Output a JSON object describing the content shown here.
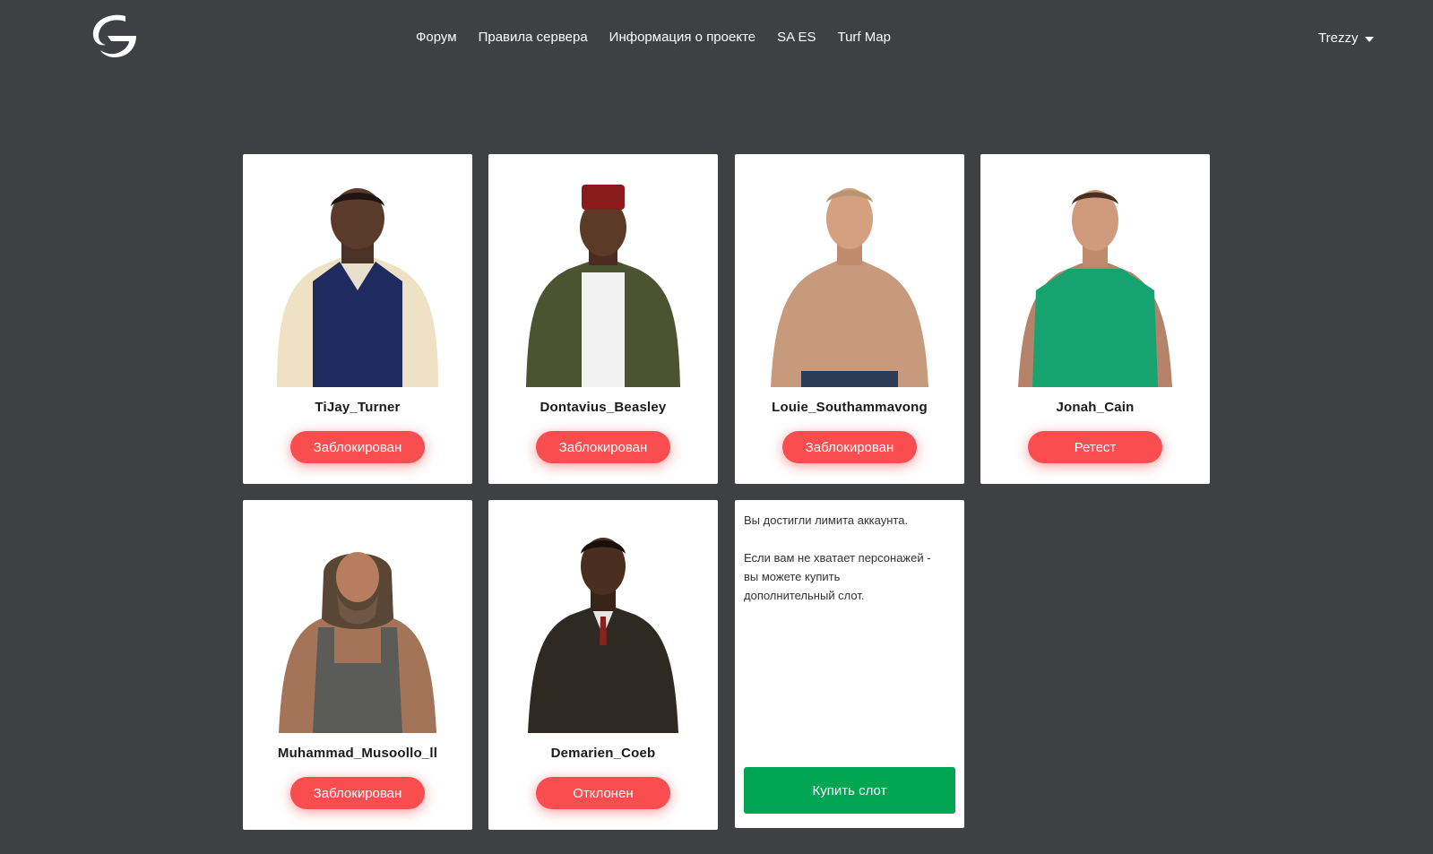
{
  "header": {
    "nav": [
      "Форум",
      "Правила сервера",
      "Информация о проекте",
      "SA ES",
      "Turf Map"
    ],
    "user": "Trezzy"
  },
  "characters": [
    {
      "name": "TiJay_Turner",
      "status": "Заблокирован"
    },
    {
      "name": "Dontavius_Beasley",
      "status": "Заблокирован"
    },
    {
      "name": "Louie_Southammavong",
      "status": "Заблокирован"
    },
    {
      "name": "Jonah_Cain",
      "status": "Ретест"
    },
    {
      "name": "Muhammad_Musoollo_ll",
      "status": "Заблокирован"
    },
    {
      "name": "Demarien_Coeb",
      "status": "Отклонен"
    }
  ],
  "limit_card": {
    "text": "Вы достигли лимита аккаунта.\n\nЕсли вам не хватает персонажей -\nвы можете купить\nдополнительный слот.",
    "button": "Купить слот"
  },
  "colors": {
    "background": "#3f4042",
    "status_red": "#fa4d4f",
    "buy_green": "#00a651"
  }
}
